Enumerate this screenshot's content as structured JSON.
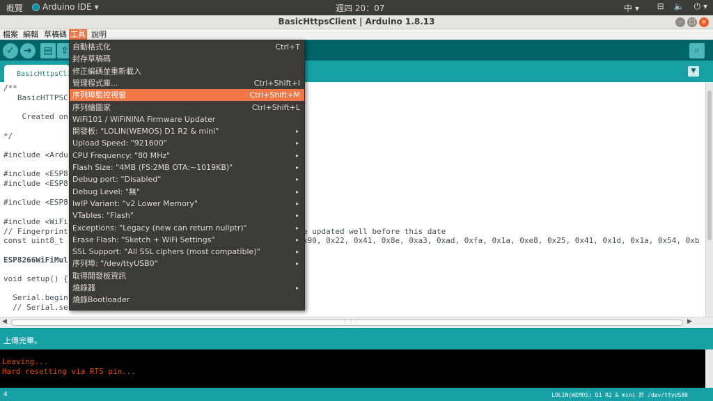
{
  "topbar": {
    "activities": "概覽",
    "app_name": "Arduino IDE",
    "clock": "週四 20：07",
    "ime": "中",
    "sys_icons": [
      "network-icon",
      "volume-icon",
      "power-icon"
    ]
  },
  "window": {
    "title": "BasicHttpsClient | Arduino 1.8.13"
  },
  "menubar": {
    "items": [
      "檔案",
      "編輯",
      "草稿碼",
      "工具",
      "說明"
    ],
    "active": "工具"
  },
  "tab": {
    "name": "BasicHttpsCli"
  },
  "editor_lines": [
    {
      "t": "/**",
      "c": "cm"
    },
    {
      "t": "   BasicHTTPSC",
      "c": "cm"
    },
    {
      "t": "",
      "c": ""
    },
    {
      "t": "    Created on",
      "c": "cm"
    },
    {
      "t": "",
      "c": ""
    },
    {
      "t": "*/",
      "c": "cm"
    },
    {
      "t": "",
      "c": ""
    },
    {
      "t": "#include <Ardu",
      "c": ""
    },
    {
      "t": "",
      "c": ""
    },
    {
      "t": "#include <ESP8",
      "c": ""
    },
    {
      "t": "#include <ESP8",
      "c": ""
    },
    {
      "t": "",
      "c": ""
    },
    {
      "t": "#include <ESP8",
      "c": ""
    },
    {
      "t": "",
      "c": ""
    },
    {
      "t": "#include <WiFi",
      "c": ""
    },
    {
      "t": "// Fingerprint",
      "c": "cm"
    },
    {
      "t": "const uint8_t ",
      "c": ""
    },
    {
      "t": "",
      "c": ""
    },
    {
      "t": "ESP8266WiFiMul",
      "c": "bold"
    },
    {
      "t": "",
      "c": ""
    },
    {
      "t": "void setup() {",
      "c": ""
    },
    {
      "t": "",
      "c": ""
    },
    {
      "t": "  Serial.begin",
      "c": ""
    },
    {
      "t": "  // Serial.se",
      "c": "cm"
    }
  ],
  "editor_right": {
    "line15": "e updated well before this date",
    "line16": "x90, 0x22, 0x41, 0x8e, 0xa3, 0xad, 0xfa, 0x1a, 0xe8, 0x25, 0x41, 0x1d, 0x1a, 0x54, 0xb"
  },
  "tools_menu": [
    {
      "label": "自動格式化",
      "shortcut": "Ctrl+T"
    },
    {
      "label": "封存草稿碼",
      "shortcut": ""
    },
    {
      "label": "修正編碼並重新載入",
      "shortcut": ""
    },
    {
      "label": "管理程式庫...",
      "shortcut": "Ctrl+Shift+I"
    },
    {
      "label": "序列埠監控視窗",
      "shortcut": "Ctrl+Shift+M",
      "highlight": true
    },
    {
      "label": "序列繪圖家",
      "shortcut": "Ctrl+Shift+L"
    },
    {
      "label": "WiFi101 / WiFiNINA Firmware Updater",
      "shortcut": ""
    },
    {
      "label": "開發板: \"LOLIN(WEMOS) D1 R2 & mini\"",
      "submenu": true
    },
    {
      "label": "Upload Speed: \"921600\"",
      "submenu": true
    },
    {
      "label": "CPU Frequency: \"80 MHz\"",
      "submenu": true
    },
    {
      "label": "Flash Size: \"4MB (FS:2MB OTA:~1019KB)\"",
      "submenu": true
    },
    {
      "label": "Debug port: \"Disabled\"",
      "submenu": true
    },
    {
      "label": "Debug Level: \"無\"",
      "submenu": true
    },
    {
      "label": "lwIP Variant: \"v2 Lower Memory\"",
      "submenu": true
    },
    {
      "label": "VTables: \"Flash\"",
      "submenu": true
    },
    {
      "label": "Exceptions: \"Legacy (new can return nullptr)\"",
      "submenu": true
    },
    {
      "label": "Erase Flash: \"Sketch + WiFi Settings\"",
      "submenu": true
    },
    {
      "label": "SSL Support: \"All SSL ciphers (most compatible)\"",
      "submenu": true
    },
    {
      "label": "序列埠: \"/dev/ttyUSB0\"",
      "submenu": true
    },
    {
      "label": "取得開發板資訊",
      "shortcut": ""
    },
    {
      "label": "燒錄器",
      "submenu": true
    },
    {
      "label": "燒錄Bootloader",
      "shortcut": ""
    }
  ],
  "status": {
    "message": "上傳完畢。"
  },
  "console": {
    "lines": [
      "Leaving...",
      "Hard resetting via RTS pin..."
    ]
  },
  "footer": {
    "line_number": "4",
    "board": "LOLIN(WEMOS) D1 R2 & mini 於 /dev/ttyUSB0"
  }
}
